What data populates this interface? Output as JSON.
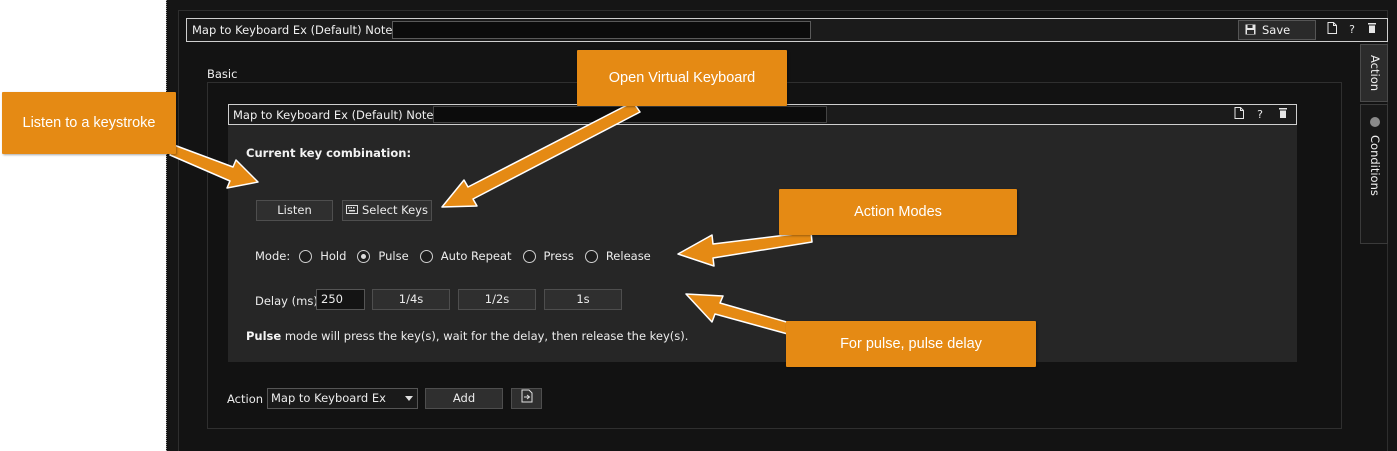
{
  "header": {
    "title": "Map to Keyboard Ex (Default)  Notes:",
    "notes_value": "",
    "save_label": "Save"
  },
  "side_tabs": {
    "action": "Action",
    "conditions": "Conditions"
  },
  "basic": {
    "label": "Basic"
  },
  "inner": {
    "title": "Map to Keyboard Ex (Default)  Notes:",
    "notes_value": "",
    "current_key_label": "Current key combination:",
    "current_key_value": "",
    "listen_label": "Listen",
    "select_keys_label": "Select Keys",
    "mode_label": "Mode:",
    "modes": [
      {
        "label": "Hold",
        "checked": false
      },
      {
        "label": "Pulse",
        "checked": true
      },
      {
        "label": "Auto Repeat",
        "checked": false
      },
      {
        "label": "Press",
        "checked": false
      },
      {
        "label": "Release",
        "checked": false
      }
    ],
    "delay_label": "Delay (ms)",
    "delay_value": "250",
    "delay_presets": [
      "1/4s",
      "1/2s",
      "1s"
    ],
    "pulse_bold": "Pulse",
    "pulse_rest": " mode will press the key(s), wait for the delay, then release the key(s)."
  },
  "action_row": {
    "label": "Action",
    "selected": "Map to Keyboard Ex",
    "add_label": "Add"
  },
  "callouts": {
    "listen": "Listen to a keystroke",
    "virtual_keyboard": "Open Virtual Keyboard",
    "action_modes": "Action Modes",
    "pulse_delay": "For pulse, pulse delay"
  },
  "colors": {
    "callout": "#e58a14",
    "background": "#151515",
    "panel": "#262626"
  },
  "icons": {
    "save": "floppy-disk-icon",
    "new": "document-icon",
    "help": "question-icon",
    "delete": "trash-icon",
    "keyboard": "keyboard-icon",
    "import": "import-icon"
  }
}
